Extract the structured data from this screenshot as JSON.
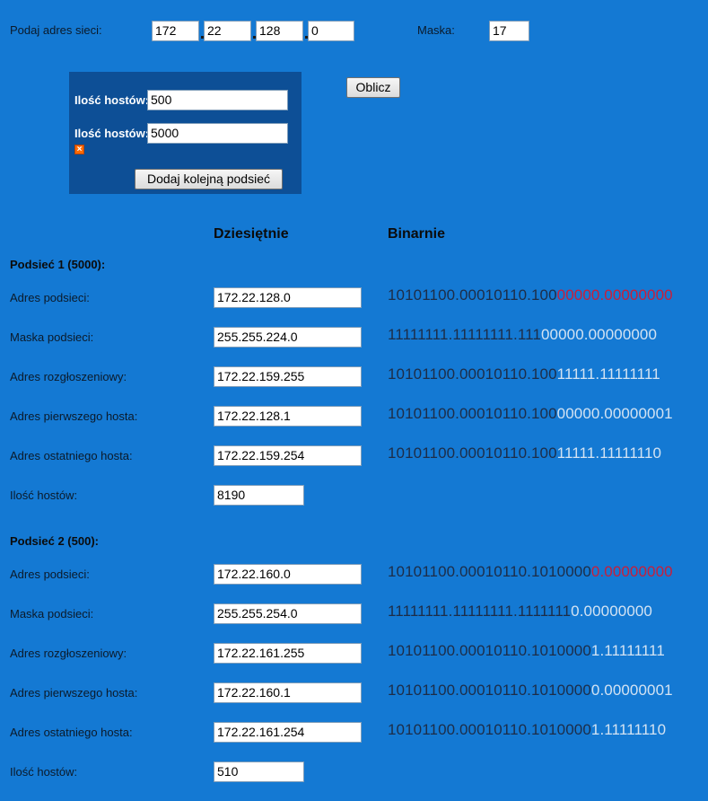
{
  "network": {
    "label": "Podaj adres sieci:",
    "octets": [
      "172",
      "22",
      "128",
      "0"
    ],
    "mask_label": "Maska:",
    "mask_value": "17"
  },
  "calculate_label": "Oblicz",
  "hosts_panel": {
    "items": [
      {
        "label": "Ilość hostów:",
        "value": "500"
      },
      {
        "label": "Ilość hostów:",
        "value": "5000"
      }
    ],
    "add_subnet_label": "Dodaj kolejną podsieć"
  },
  "headers": {
    "decimal": "Dziesiętnie",
    "binary": "Binarnie"
  },
  "subnets": [
    {
      "title": "Podsieć 1 (5000):",
      "rows": [
        {
          "label": "Adres podsieci:",
          "decimal": "172.22.128.0",
          "bin_net": "10101100.00010110.100",
          "bin_host": "00000.00000000",
          "host_color": "red"
        },
        {
          "label": "Maska podsieci:",
          "decimal": "255.255.224.0",
          "bin_net": "11111111.11111111.111",
          "bin_host": "00000.00000000",
          "host_color": "white"
        },
        {
          "label": "Adres rozgłoszeniowy:",
          "decimal": "172.22.159.255",
          "bin_net": "10101100.00010110.100",
          "bin_host": "11111.11111111",
          "host_color": "white"
        },
        {
          "label": "Adres pierwszego hosta:",
          "decimal": "172.22.128.1",
          "bin_net": "10101100.00010110.100",
          "bin_host": "00000.00000001",
          "host_color": "white"
        },
        {
          "label": "Adres ostatniego hosta:",
          "decimal": "172.22.159.254",
          "bin_net": "10101100.00010110.100",
          "bin_host": "11111.11111110",
          "host_color": "white"
        }
      ],
      "hosts_label": "Ilość hostów:",
      "hosts_value": "8190"
    },
    {
      "title": "Podsieć 2 (500):",
      "rows": [
        {
          "label": "Adres podsieci:",
          "decimal": "172.22.160.0",
          "bin_net": "10101100.00010110.1010000",
          "bin_host": "0.00000000",
          "host_color": "red"
        },
        {
          "label": "Maska podsieci:",
          "decimal": "255.255.254.0",
          "bin_net": "11111111.11111111.1111111",
          "bin_host": "0.00000000",
          "host_color": "white"
        },
        {
          "label": "Adres rozgłoszeniowy:",
          "decimal": "172.22.161.255",
          "bin_net": "10101100.00010110.1010000",
          "bin_host": "1.11111111",
          "host_color": "white"
        },
        {
          "label": "Adres pierwszego hosta:",
          "decimal": "172.22.160.1",
          "bin_net": "10101100.00010110.1010000",
          "bin_host": "0.00000001",
          "host_color": "white"
        },
        {
          "label": "Adres ostatniego hosta:",
          "decimal": "172.22.161.254",
          "bin_net": "10101100.00010110.1010000",
          "bin_host": "1.11111110",
          "host_color": "white"
        }
      ],
      "hosts_label": "Ilość hostów:",
      "hosts_value": "510"
    }
  ],
  "colors": {
    "background": "#1479d3",
    "panel": "#0d4f96",
    "binary_host_highlight": "#c81e3a",
    "binary_host_light": "#d3e3f3",
    "binary_network": "#1d2d48"
  },
  "icons": {
    "remove_host_field": "close-icon"
  }
}
